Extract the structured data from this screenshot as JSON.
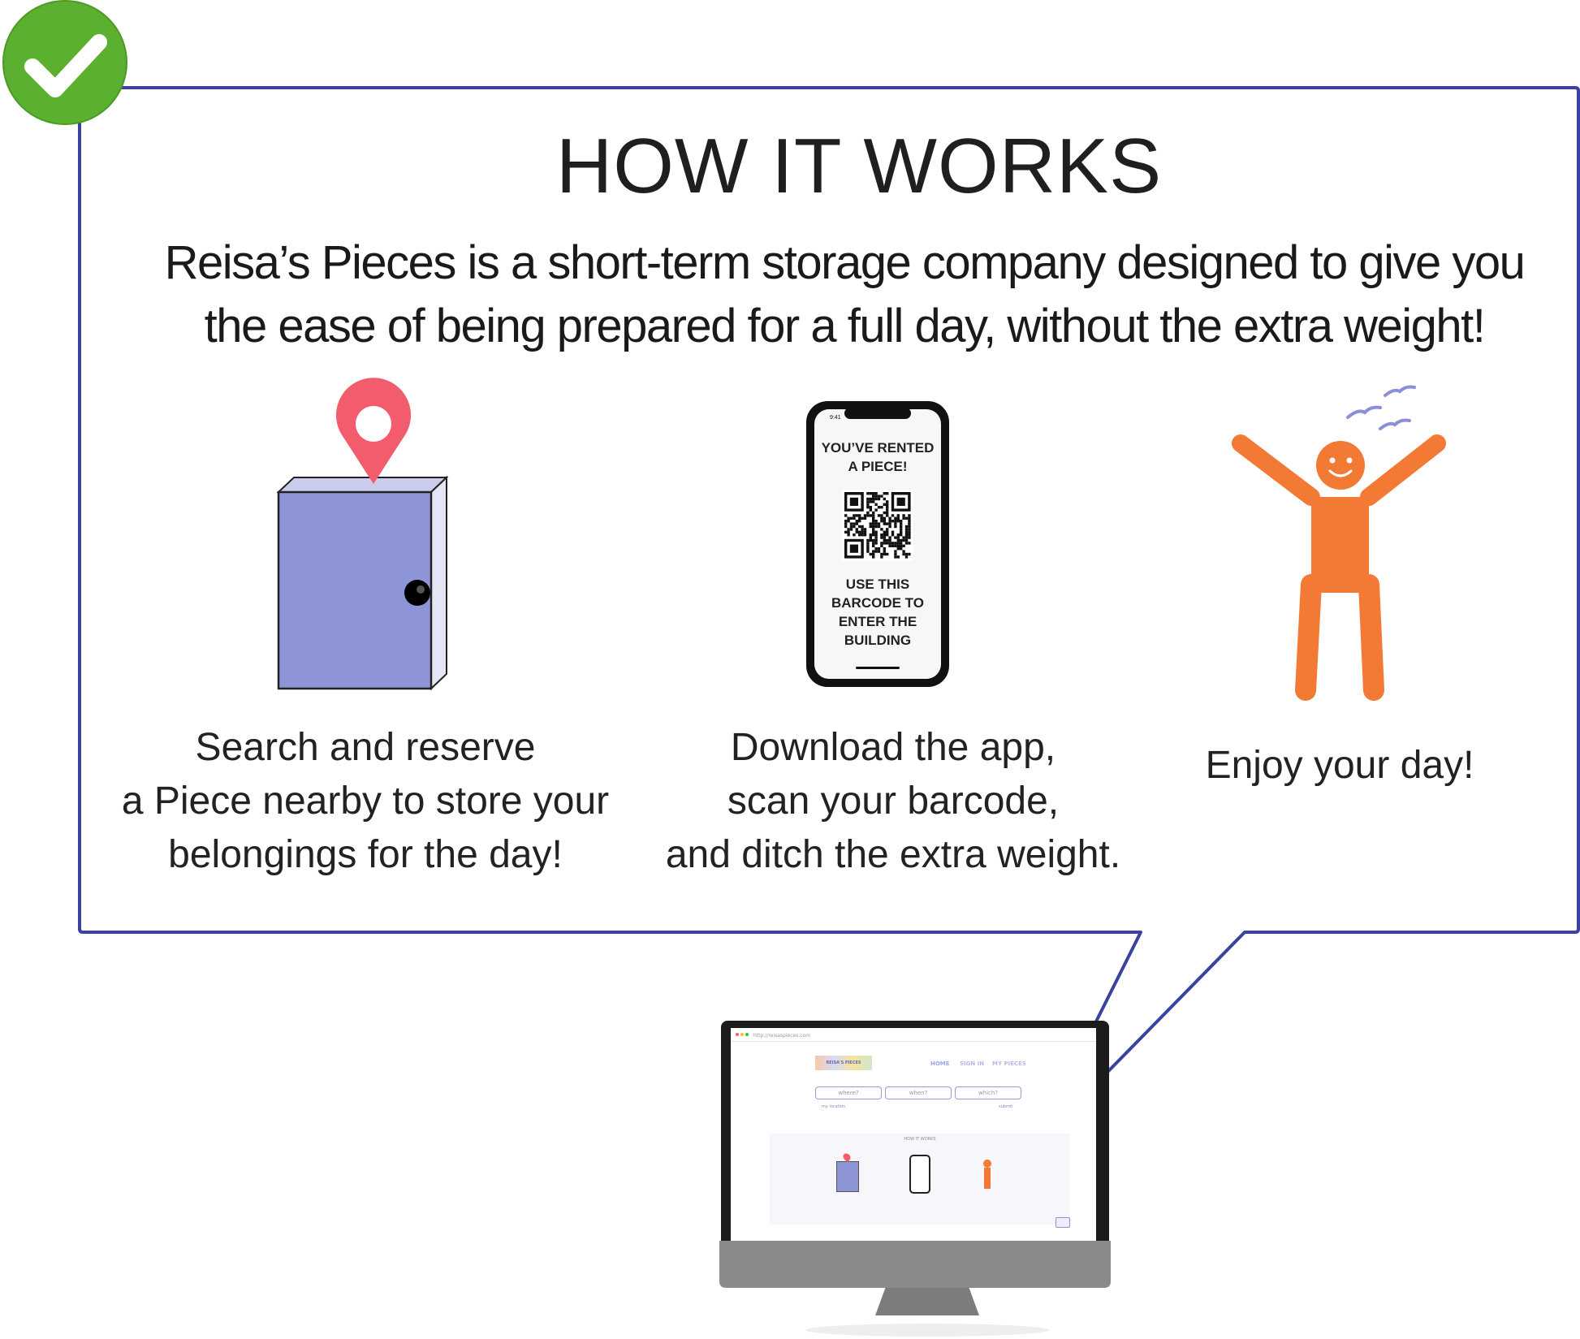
{
  "status": {
    "check_color": "#5bb02f"
  },
  "colors": {
    "bubble_border": "#3b42a0",
    "door": "#8e95d6",
    "pin": "#f25c6d",
    "person": "#f27a35",
    "birds": "#8b8fd8"
  },
  "how_it_works": {
    "title": "HOW IT WORKS",
    "description": "Reisa’s Pieces is a short-term storage company designed to give you the ease of being prepared for a full day, without the extra weight!",
    "steps": [
      {
        "icon": "storage-door-with-pin-icon",
        "text_lines": [
          "Search and reserve",
          "a Piece nearby to store your",
          "belongings for the day!"
        ]
      },
      {
        "icon": "phone-barcode-icon",
        "text_lines": [
          "Download the app,",
          "scan your barcode,",
          "and ditch the extra weight."
        ]
      },
      {
        "icon": "happy-person-icon",
        "text_lines": [
          "Enjoy your day!"
        ]
      }
    ],
    "phone": {
      "time": "9:41",
      "heading_lines": [
        "YOU’VE RENTED",
        "A PIECE!"
      ],
      "instruction_lines": [
        "USE THIS",
        "BARCODE TO",
        "ENTER THE",
        "BUILDING"
      ]
    }
  },
  "monitor": {
    "url": "http://reisaspieces.com",
    "logo": "REISA'S PIECES",
    "nav": [
      "HOME",
      "SIGN IN",
      "MY PIECES"
    ],
    "fields": [
      "where?",
      "when?",
      "which?"
    ],
    "use_location": "my location",
    "submit": "submit",
    "mini_title": "HOW IT WORKS"
  }
}
